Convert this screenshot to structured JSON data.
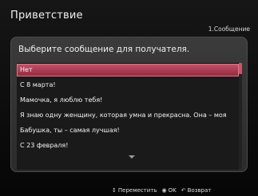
{
  "header": {
    "title": "Приветствие",
    "step": "1.Сообщение"
  },
  "panel": {
    "prompt": "Выберите сообщение для получателя.",
    "items": [
      "Нет",
      "С 8 марта!",
      "Мамочка, я люблю тебя!",
      "Я знаю одну женщину, которая умна и прекрасна. Она – моя",
      "Бабушка, ты – самая лучшая!",
      "С 23 февраля!"
    ],
    "selected_index": 0
  },
  "footer": {
    "move_icon": "updown-arrows-icon",
    "move_label": "Переместить",
    "ok_icon": "ok-dot-icon",
    "ok_label": "OK",
    "back_icon": "return-arrow-icon",
    "back_label": "Возврат"
  }
}
